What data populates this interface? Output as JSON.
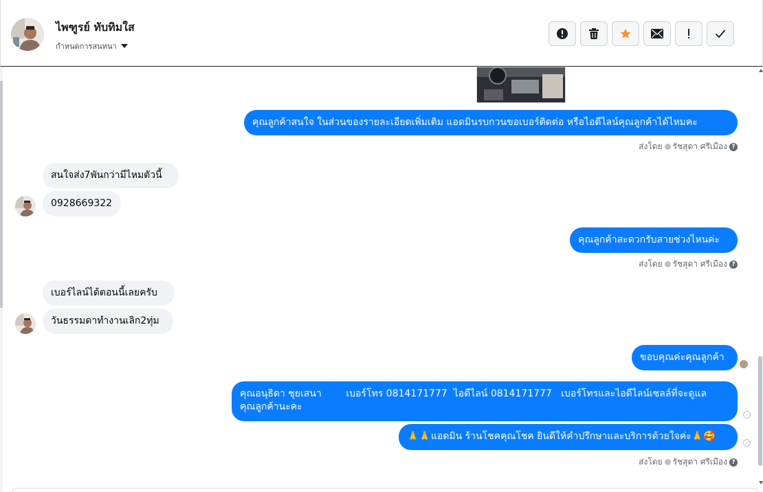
{
  "header": {
    "contact_name": "ไพฑูรย์ ทับทิมใส",
    "assign_label": "กำหนดการสนทนา",
    "toolbar": [
      {
        "name": "spam-button",
        "icon": "alert-circle-icon"
      },
      {
        "name": "delete-button",
        "icon": "trash-icon"
      },
      {
        "name": "star-button",
        "icon": "star-icon"
      },
      {
        "name": "mark-unread-button",
        "icon": "envelope-icon"
      },
      {
        "name": "follow-up-button",
        "icon": "exclamation-icon"
      },
      {
        "name": "done-button",
        "icon": "checkmark-icon"
      }
    ]
  },
  "colors": {
    "outgoing_bubble": "#0a7cff",
    "incoming_bubble": "#f0f2f5",
    "star": "#f7923b"
  },
  "messages": {
    "m1": "คุณลูกค้าสนใจ ในส่วนของรายละเอียดเพิ่มเติม แอดมินรบกวนขอเบอร์ติดต่อ หรือไอดีไลน์คุณลูกค้าได้ไหมคะ",
    "m2": "สนใจส่ง7พันกว่ามีไหมตัวนี้",
    "m3": "0928669322",
    "m4": "คุณลูกค้าสะดวกรับสายช่วงไหนค่ะ",
    "m5": "เบอร์ไลน์ได้ตอนนี้เลยครับ",
    "m6": "วันธรรมดาทำงานเลิก2ทุ่ม",
    "m7": "ขอบคุณค่ะคุณลูกค้า",
    "m8_line1": "คุณอนุธิดา ชุยเสนา        เบอร์โทร 0814171777  ไอดีไลน์ 0814171777   เบอร์โทรและไอดีไลน์เซลล์ที่จะดูแล",
    "m8_line2": "คุณลูกค้านะคะ",
    "m9": "🙏🙏แอดมิน ร้านโชคคุณโชค ยินดีให้คำปรึกษาและบริการด้วยใจค่ะ🙏🥰"
  },
  "sent_by": {
    "prefix": "ส่งโดย",
    "name": "รัชสุดา ศรีเมือง"
  }
}
